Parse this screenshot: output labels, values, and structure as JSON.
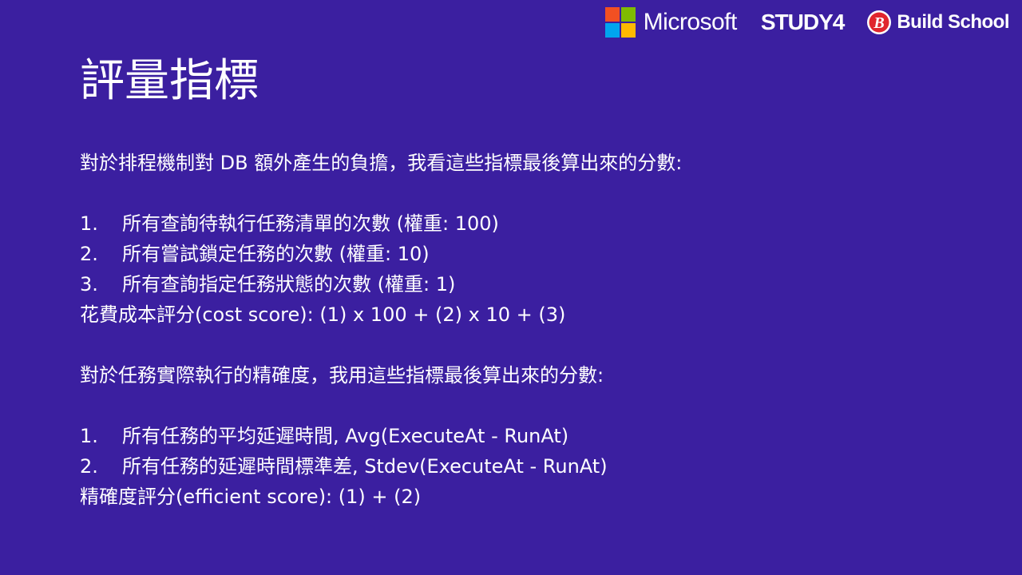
{
  "logos": {
    "microsoft": "Microsoft",
    "study4": "STUDY4",
    "build_school": "Build School",
    "colors": {
      "ms_red": "#f25022",
      "ms_green": "#7fba00",
      "ms_blue": "#00a4ef",
      "ms_yellow": "#ffb900",
      "build_school_red": "#e0262e"
    }
  },
  "background_color": "#3b1fa0",
  "title": "評量指標",
  "cost_section": {
    "intro": "對於排程機制對 DB 額外產生的負擔，我看這些指標最後算出來的分數:",
    "items": [
      {
        "num": "1.",
        "text": "所有查詢待執行任務清單的次數 (權重: 100)"
      },
      {
        "num": "2.",
        "text": "所有嘗試鎖定任務的次數 (權重: 10)"
      },
      {
        "num": "3.",
        "text": "所有查詢指定任務狀態的次數 (權重: 1)"
      }
    ],
    "formula": "花費成本評分(cost score): (1) x 100 + (2) x 10 + (3)"
  },
  "precision_section": {
    "intro": "對於任務實際執行的精確度，我用這些指標最後算出來的分數:",
    "items": [
      {
        "num": "1.",
        "text": "所有任務的平均延遲時間, Avg(ExecuteAt - RunAt)"
      },
      {
        "num": "2.",
        "text": "所有任務的延遲時間標準差, Stdev(ExecuteAt - RunAt)"
      }
    ],
    "formula": "精確度評分(efficient score): (1) + (2)"
  }
}
